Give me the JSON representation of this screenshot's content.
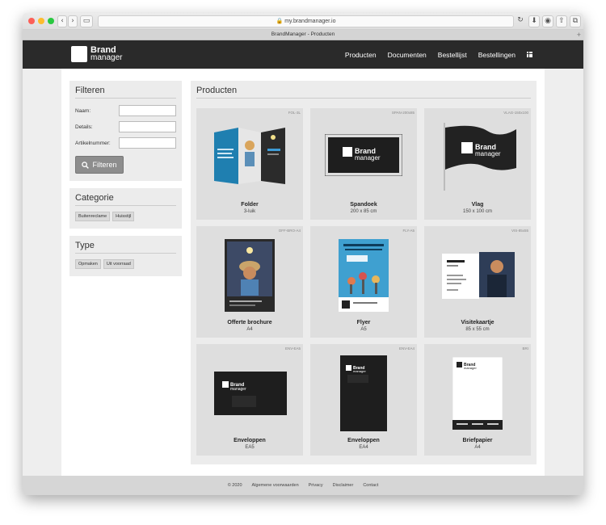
{
  "browser": {
    "url": "my.brandmanager.io",
    "tab_title": "BrandManager - Producten"
  },
  "logo": {
    "line1": "Brand",
    "line2": "manager"
  },
  "nav": {
    "items": [
      "Producten",
      "Documenten",
      "Bestellijst",
      "Bestellingen"
    ],
    "apps_icon": "grid-icon"
  },
  "filter": {
    "title": "Filteren",
    "fields": [
      {
        "label": "Naam:",
        "value": ""
      },
      {
        "label": "Details:",
        "value": ""
      },
      {
        "label": "Artikelnummer:",
        "value": ""
      }
    ],
    "button": "Filteren",
    "button_icon": "search-icon"
  },
  "category": {
    "title": "Categorie",
    "tags": [
      "Buitenreclame",
      "Huisstijl"
    ]
  },
  "type": {
    "title": "Type",
    "tags": [
      "Opmaken",
      "Uit voorraad"
    ]
  },
  "products": {
    "title": "Producten",
    "items": [
      {
        "code": "FOL-3L",
        "name": "Folder",
        "sub": "3-luik"
      },
      {
        "code": "SPAN-200x85",
        "name": "Spandoek",
        "sub": "200 x 85 cm"
      },
      {
        "code": "VLAG-150x100",
        "name": "Vlag",
        "sub": "150 x 100 cm"
      },
      {
        "code": "OFF-BRO-A4",
        "name": "Offerte brochure",
        "sub": "A4"
      },
      {
        "code": "FLY-A5",
        "name": "Flyer",
        "sub": "A5"
      },
      {
        "code": "VIS-85x55",
        "name": "Visitekaartje",
        "sub": "85 x 55 cm"
      },
      {
        "code": "ENV-EA5",
        "name": "Enveloppen",
        "sub": "EA5"
      },
      {
        "code": "ENV-EA4",
        "name": "Enveloppen",
        "sub": "EA4"
      },
      {
        "code": "BRI",
        "name": "Briefpapier",
        "sub": "A4"
      }
    ]
  },
  "footer": {
    "items": [
      "© 2020",
      "Algemene voorwaarden",
      "Privacy",
      "Disclaimer",
      "Contact"
    ]
  }
}
